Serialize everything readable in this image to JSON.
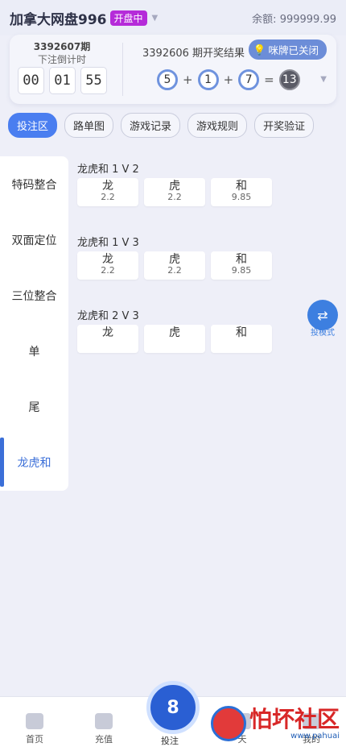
{
  "header": {
    "title": "加拿大网盘996",
    "status_badge": "开盘中",
    "balance_label": "余额:",
    "balance_value": "999999.99"
  },
  "draw": {
    "current_period": "3392607期",
    "countdown_label": "下注倒计时",
    "timer": [
      "00",
      "01",
      "55"
    ],
    "result_label": "3392606 期开奖结果",
    "toggle_label": "咪牌已关闭",
    "balls": [
      "5",
      "1",
      "7"
    ],
    "sum": "13"
  },
  "tabs": [
    "投注区",
    "路单图",
    "游戏记录",
    "游戏规则",
    "开奖验证"
  ],
  "sidebar": {
    "items": [
      "特码整合",
      "双面定位",
      "三位整合",
      "单",
      "尾",
      "龙虎和"
    ]
  },
  "groups": [
    {
      "title": "龙虎和 1 V 2",
      "options": [
        {
          "name": "龙",
          "odds": "2.2"
        },
        {
          "name": "虎",
          "odds": "2.2"
        },
        {
          "name": "和",
          "odds": "9.85"
        }
      ]
    },
    {
      "title": "龙虎和 1 V 3",
      "options": [
        {
          "name": "龙",
          "odds": "2.2"
        },
        {
          "name": "虎",
          "odds": "2.2"
        },
        {
          "name": "和",
          "odds": "9.85"
        }
      ]
    },
    {
      "title": "龙虎和 2 V 3",
      "options": [
        {
          "name": "龙",
          "odds": ""
        },
        {
          "name": "虎",
          "odds": ""
        },
        {
          "name": "和",
          "odds": ""
        }
      ]
    }
  ],
  "float_button": {
    "label": "投模式"
  },
  "bottom_nav": {
    "items": [
      "首页",
      "充值",
      "投注",
      "天",
      "我的"
    ],
    "center_glyph": "8"
  },
  "watermark": {
    "text": "怕坏社区",
    "sub": "www.pahuai"
  }
}
